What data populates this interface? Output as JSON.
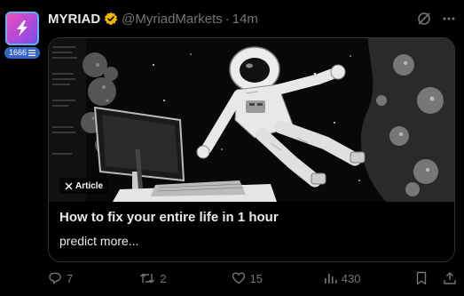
{
  "post": {
    "author_name": "MYRIAD",
    "handle": "@MyriadMarkets",
    "separator": "·",
    "time": "14m",
    "level_badge": "1666",
    "card": {
      "tag": "Article",
      "title": "How to fix your entire life in 1 hour",
      "subtitle": "predict more..."
    },
    "actions": {
      "replies": "7",
      "reposts": "2",
      "likes": "15",
      "views": "430"
    }
  },
  "icons": [
    "verified-badge-icon",
    "grok-icon",
    "more-options-icon",
    "reply-icon",
    "repost-icon",
    "like-icon",
    "views-icon",
    "bookmark-icon",
    "share-icon",
    "x-logo-icon"
  ],
  "colors": {
    "background": "#000000",
    "text": "#e7e9ea",
    "muted": "#71767b",
    "verified": "#f4b400",
    "level_badge": "#3866c7"
  }
}
